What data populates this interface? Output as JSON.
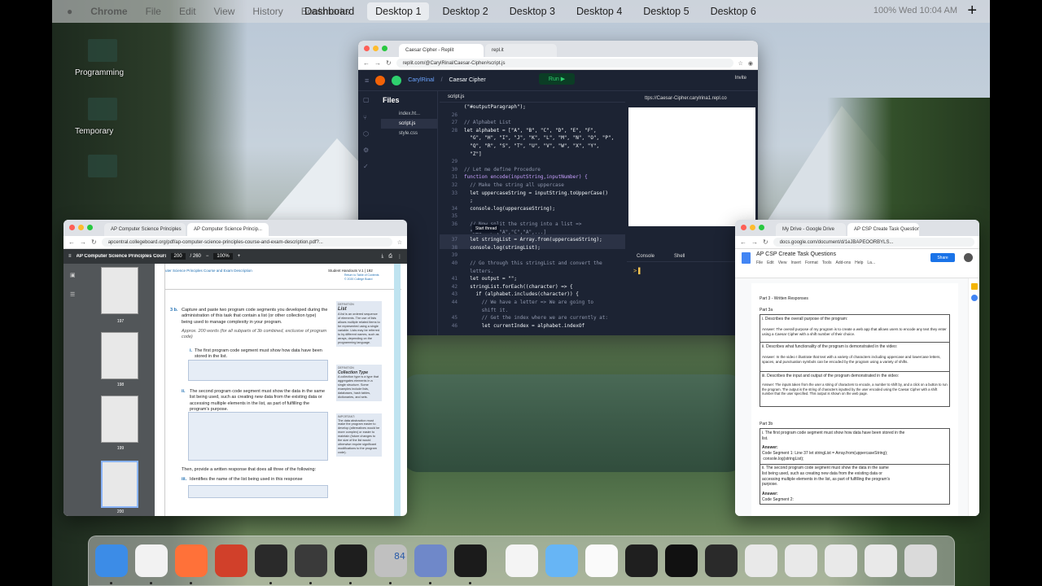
{
  "menubar": {
    "app": "Chrome",
    "items": [
      "File",
      "Edit",
      "View",
      "History",
      "Bookmarks"
    ],
    "right": "100% Wed 10:04 AM"
  },
  "spaces": [
    "Dashboard",
    "Desktop 1",
    "Desktop 2",
    "Desktop 3",
    "Desktop 4",
    "Desktop 5",
    "Desktop 6"
  ],
  "active_space": "Desktop 1",
  "add_space": "+",
  "desktop": {
    "labels": [
      "Programming",
      "Temporary"
    ]
  },
  "repl": {
    "tabs": [
      "Caesar Cipher - Replit",
      "repl.it"
    ],
    "url": "replit.com/@CarylRinal/Caesar-Cipher#script.js",
    "user": "CarylRinal",
    "title": "Caesar Cipher",
    "run": "Run ▶",
    "invite": "Invite",
    "files_title": "Files",
    "files": [
      "index.ht...",
      "script.js",
      "style.css"
    ],
    "editor_tab": "script.js",
    "code": [
      {
        "n": "",
        "t": "(\"#outputParagraph\");",
        "c": ""
      },
      {
        "n": "26",
        "t": "",
        "c": ""
      },
      {
        "n": "27",
        "t": "// Alphabet List",
        "c": "cm"
      },
      {
        "n": "28",
        "t": "let alphabet = [\"A\", \"B\", \"C\", \"D\", \"E\", \"F\",",
        "c": ""
      },
      {
        "n": "",
        "t": "  \"G\", \"H\", \"I\", \"J\", \"K\", \"L\", \"M\", \"N\", \"O\", \"P\",",
        "c": ""
      },
      {
        "n": "",
        "t": "  \"Q\", \"R\", \"S\", \"T\", \"U\", \"V\", \"W\", \"X\", \"Y\",",
        "c": ""
      },
      {
        "n": "",
        "t": "  \"Z\"]",
        "c": ""
      },
      {
        "n": "29",
        "t": "",
        "c": ""
      },
      {
        "n": "30",
        "t": "// Let me define Procedure",
        "c": "cm"
      },
      {
        "n": "31",
        "t": "function encode(inputString,inputNumber) {",
        "c": "kw"
      },
      {
        "n": "32",
        "t": "  // Make the string all uppercase",
        "c": "cm"
      },
      {
        "n": "33",
        "t": "  let uppercaseString = inputString.toUpperCase()",
        "c": ""
      },
      {
        "n": "",
        "t": "  ;",
        "c": ""
      },
      {
        "n": "34",
        "t": "  console.log(uppercaseString);",
        "c": ""
      },
      {
        "n": "35",
        "t": "",
        "c": ""
      },
      {
        "n": "36",
        "t": "  // Now split the string into a list =>",
        "c": "cm"
      },
      {
        "n": "",
        "t": "  \"ABC\" => [\"A\",\"C\",\"A\",...]",
        "c": "cm"
      },
      {
        "n": "37",
        "t": "  let stringList = Array.from(uppercaseString);",
        "c": ""
      },
      {
        "n": "38",
        "t": "  console.log(stringList);",
        "c": ""
      },
      {
        "n": "39",
        "t": "",
        "c": ""
      },
      {
        "n": "40",
        "t": "  // Go through this stringList and convert the",
        "c": "cm"
      },
      {
        "n": "",
        "t": "  letters.",
        "c": "cm"
      },
      {
        "n": "41",
        "t": "  let output = \"\";",
        "c": ""
      },
      {
        "n": "42",
        "t": "  stringList.forEach((character) => {",
        "c": ""
      },
      {
        "n": "43",
        "t": "    if (alphabet.includes(character)) {",
        "c": ""
      },
      {
        "n": "44",
        "t": "      // We have a letter => We are going to",
        "c": "cm"
      },
      {
        "n": "",
        "t": "      shift it.",
        "c": "cm"
      },
      {
        "n": "45",
        "t": "      // Get the index where we are currently at:",
        "c": "cm"
      },
      {
        "n": "46",
        "t": "      let currentIndex = alphabet.indexOf",
        "c": ""
      }
    ],
    "start_thread": "Start thread",
    "webview_url": "ttps://Caesar-Cipher.carylrina1.repl.co",
    "console_tabs": [
      "Console",
      "Shell"
    ],
    "prompt": "> ▌"
  },
  "pdf": {
    "tabs": [
      "AP Computer Science Principles",
      "AP Computer Science Princip..."
    ],
    "url": "apcentral.collegeboard.org/pdf/ap-computer-science-principles-course-and-exam-description.pdf?...",
    "doc_title": "AP Computer Science Principles Course ...",
    "page": "200",
    "page_total": "/ 260",
    "zoom": "100%",
    "thumbs": [
      "197",
      "198",
      "199",
      "200"
    ],
    "header_left": "uter Science Principles Course and Exam Description",
    "header_right": "Student Handouts V.1  |  192",
    "header_small": "Return to Table of Contents\n© 2020 College Board",
    "q_num": "3 b.",
    "q_text": "Capture and paste two program code segments you developed during the administration of this task that contain a list (or other collection type) being used to manage complexity in your program.",
    "q_note": "Approx. 200 words (for all subparts of 3b combined, exclusive of program code)",
    "sub_i": "i.",
    "sub_i_text": "The first program code segment must show how data have been stored in the list.",
    "sub_ii": "ii.",
    "sub_ii_text": "The second program code segment must show the data in the same list being used, such as creating new data from the existing data or accessing multiple elements in the list, as part of fulfilling the program's purpose.",
    "then_text": "Then, provide a written response that does all three of the following:",
    "sub_iii": "iii.",
    "sub_iii_text": "Identifies the name of the list being used in this response",
    "def1_label": "DEFINITION",
    "def1_title": "List",
    "def1_body": "A list is an ordered sequence of elements. The use of lists allows multiple related items to be represented using a single variable. Lists may be referred to by different names, such as arrays, depending on the programming language.",
    "def2_label": "DEFINITION",
    "def2_title": "Collection Type",
    "def2_body": "A collection type is a type that aggregates elements in a single structure. Some examples include lists, databases, hash tables, dictionaries, and sets.",
    "imp_label": "IMPORTANT:",
    "imp_body": "The data abstraction must make the program easier to develop (alternatives would be more complex) or easier to maintain (future changes to the size of the list would otherwise require significant modifications to the program code)."
  },
  "docs": {
    "tabs": [
      "My Drive - Google Drive",
      "AP CSP Create Task Question"
    ],
    "url": "docs.google.com/document/d/1eJBAPEOORBYLS...",
    "title": "AP CSP Create Task Questions",
    "menu": [
      "File",
      "Edit",
      "View",
      "Insert",
      "Format",
      "Tools",
      "Add-ons",
      "Help",
      "La..."
    ],
    "share": "Share",
    "toolbar": "100%   Normal text   Arial   11",
    "part3": "Part 3 - Written Responses",
    "part3a": "Part 3a",
    "a_i_q": "i. Describes the overall purpose of the program:",
    "a_i_a": "Answer: The overall purpose of my program is to create a web app that allows users to encode any text they enter using a Caesar Cipher with a shift number of their choice.",
    "a_ii_q": "ii. Describes what functionality of the program is demonstrated in the video:",
    "a_ii_a": "Answer: In the video I illustrate that text with a variety of characters including uppercase and lowercase letters, spaces, and punctuation symbols can be encoded by the program using a variety of shifts.",
    "a_iii_q": "iii. Describes the input and output of the program demonstrated in the video:",
    "a_iii_a": "Answer: The inputs taken from the user a string of characters to encode, a number to shift by, and a click on a button to run the program. The output is the string of characters inputted by the user encoded using the Caesar Cipher with a shift number that the user specified. This output is shown on the web page.",
    "part3b": "Part 3b",
    "b_i_q": "i. The first program code segment must show how data have been stored in the list.",
    "b_i_ans": "Answer:",
    "b_i_code": "Code Segment 1: Line 37 let stringList = Array.from(uppercaseString);\n console.log(stringList);",
    "b_ii_q": "ii. The second program code segment must show the data in the same list being used, such as creating new data from the existing data or accessing multiple elements in the list, as part of fulfilling the program's purpose.",
    "b_ii_ans": "Answer:",
    "b_ii_code": "Code Segment 2:"
  },
  "dock": {
    "apps": [
      "finder-icon",
      "chrome-icon",
      "firefox-icon",
      "mathematica-icon",
      "terminal-icon",
      "sublime-icon",
      "shell-terminal-icon",
      "calculator-icon",
      "geogebra-icon",
      "quicktime-icon",
      "document-icon",
      "folder-icon",
      "blank-doc-icon",
      "screenshot-icon",
      "terminal-window-icon",
      "sublime-window-icon",
      "chrome-window-icon",
      "chrome-window-icon",
      "chrome-window-icon",
      "chrome-window-icon",
      "trash-icon"
    ],
    "badge": "84"
  }
}
